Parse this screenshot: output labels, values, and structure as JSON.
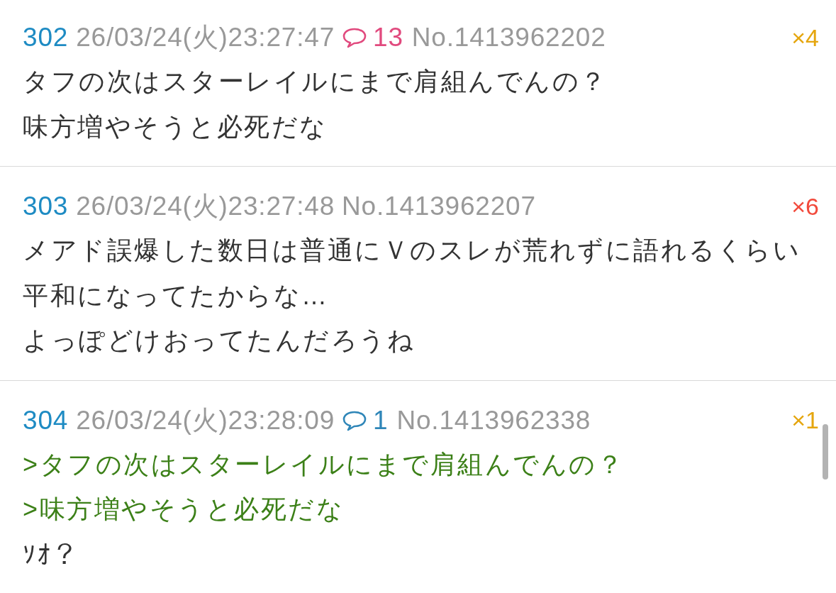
{
  "posts": [
    {
      "number": "302",
      "date": "26/03/24(火)23:27:47",
      "replies": {
        "count": "13",
        "color": "#e14a7e"
      },
      "id": "No.1413962202",
      "score": {
        "text": "×4",
        "color": "#e5a60f"
      },
      "lines": [
        {
          "kind": "text",
          "text": "タフの次はスターレイルにまで肩組んでんの？"
        },
        {
          "kind": "text",
          "text": "味方増やそうと必死だな"
        }
      ]
    },
    {
      "number": "303",
      "date": "26/03/24(火)23:27:48",
      "id": "No.1413962207",
      "score": {
        "text": "×6",
        "color": "#f24a3c"
      },
      "lines": [
        {
          "kind": "text",
          "text": "メアド誤爆した数日は普通にＶのスレが荒れずに語れるくらい"
        },
        {
          "kind": "text",
          "text": "平和になってたからな…"
        },
        {
          "kind": "text",
          "text": "よっぽどけおってたんだろうね"
        }
      ]
    },
    {
      "number": "304",
      "date": "26/03/24(火)23:28:09",
      "replies": {
        "count": "1",
        "color": "#2f86b8"
      },
      "id": "No.1413962338",
      "score": {
        "text": "×1",
        "color": "#e5a60f"
      },
      "lines": [
        {
          "kind": "quote",
          "text": ">タフの次はスターレイルにまで肩組んでんの？"
        },
        {
          "kind": "quote",
          "text": ">味方増やそうと必死だな"
        },
        {
          "kind": "text",
          "text": "ｿｵ？"
        }
      ]
    }
  ]
}
